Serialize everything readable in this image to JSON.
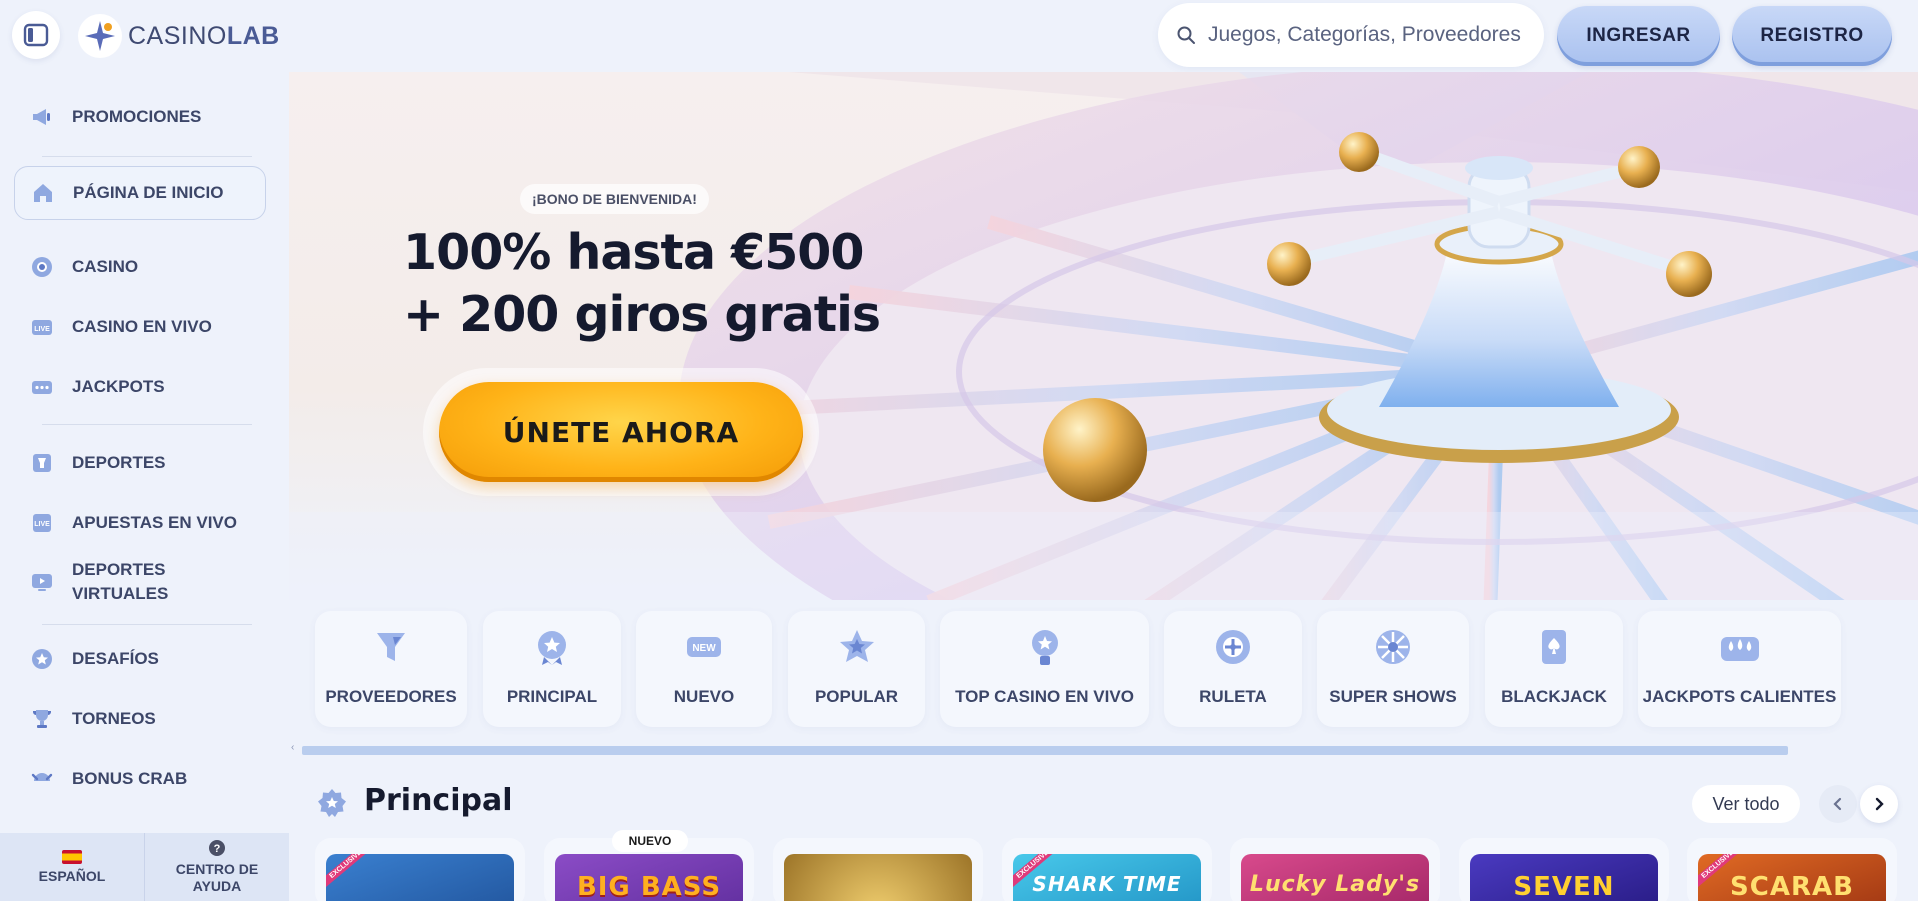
{
  "header": {
    "logo": {
      "prefix": "CASINO",
      "suffix": "LAB"
    },
    "search_placeholder": "Juegos, Categorías, Proveedores",
    "login_label": "INGRESAR",
    "register_label": "REGISTRO"
  },
  "sidebar": {
    "items": [
      {
        "label": "PROMOCIONES",
        "icon": "megaphone-icon"
      },
      {
        "label": "PÁGINA DE INICIO",
        "icon": "home-icon",
        "active": true
      },
      {
        "label": "CASINO",
        "icon": "chip-icon"
      },
      {
        "label": "CASINO EN VIVO",
        "icon": "live-icon"
      },
      {
        "label": "JACKPOTS",
        "icon": "jackpot-icon"
      },
      {
        "label": "DEPORTES",
        "icon": "sports-icon"
      },
      {
        "label": "APUESTAS EN VIVO",
        "icon": "live-bets-icon"
      },
      {
        "label": "DEPORTES\nVIRTUALES",
        "icon": "virtual-sports-icon"
      },
      {
        "label": "DESAFÍOS",
        "icon": "challenge-icon"
      },
      {
        "label": "TORNEOS",
        "icon": "trophy-icon"
      },
      {
        "label": "BONUS CRAB",
        "icon": "crab-icon"
      }
    ],
    "footer": {
      "language_label": "ESPAÑOL",
      "help_label": "CENTRO DE AYUDA"
    }
  },
  "hero": {
    "badge": "¡BONO DE BIENVENIDA!",
    "title_line1": "100% hasta €500",
    "title_line2": "+ 200 giros gratis",
    "cta_label": "ÚNETE AHORA"
  },
  "categories": [
    {
      "label": "PROVEEDORES",
      "icon": "funnel-icon"
    },
    {
      "label": "PRINCIPAL",
      "icon": "badge-star-icon"
    },
    {
      "label": "NUEVO",
      "icon": "new-icon"
    },
    {
      "label": "POPULAR",
      "icon": "star-icon"
    },
    {
      "label": "TOP CASINO EN VIVO",
      "icon": "medal-icon"
    },
    {
      "label": "RULETA",
      "icon": "roulette-icon"
    },
    {
      "label": "SUPER SHOWS",
      "icon": "wheel-icon"
    },
    {
      "label": "BLACKJACK",
      "icon": "card-icon"
    },
    {
      "label": "JACKPOTS CALIENTES",
      "icon": "drops-icon"
    }
  ],
  "section": {
    "title": "Principal",
    "view_all": "Ver todo",
    "new_badge": "NUEVO",
    "exclusive_badge": "EXCLUSIVE"
  },
  "games": [
    {
      "title": "",
      "color": "#2f6fb8"
    },
    {
      "title": "BIG BASS",
      "color": "#7a3bb6"
    },
    {
      "title": "",
      "color": "#b88a2e"
    },
    {
      "title": "SHARK TIME",
      "color": "#2fb0d6"
    },
    {
      "title": "Lucky Lady's",
      "color": "#c23a7a"
    },
    {
      "title": "SEVEN",
      "color": "#3a2aa8"
    },
    {
      "title": "SCARAB",
      "color": "#c44a1a"
    }
  ],
  "colors": {
    "accent": "#a9c1ef",
    "cta": "#ffb318",
    "text_dark": "#151a2e",
    "background": "#eef2fb"
  }
}
